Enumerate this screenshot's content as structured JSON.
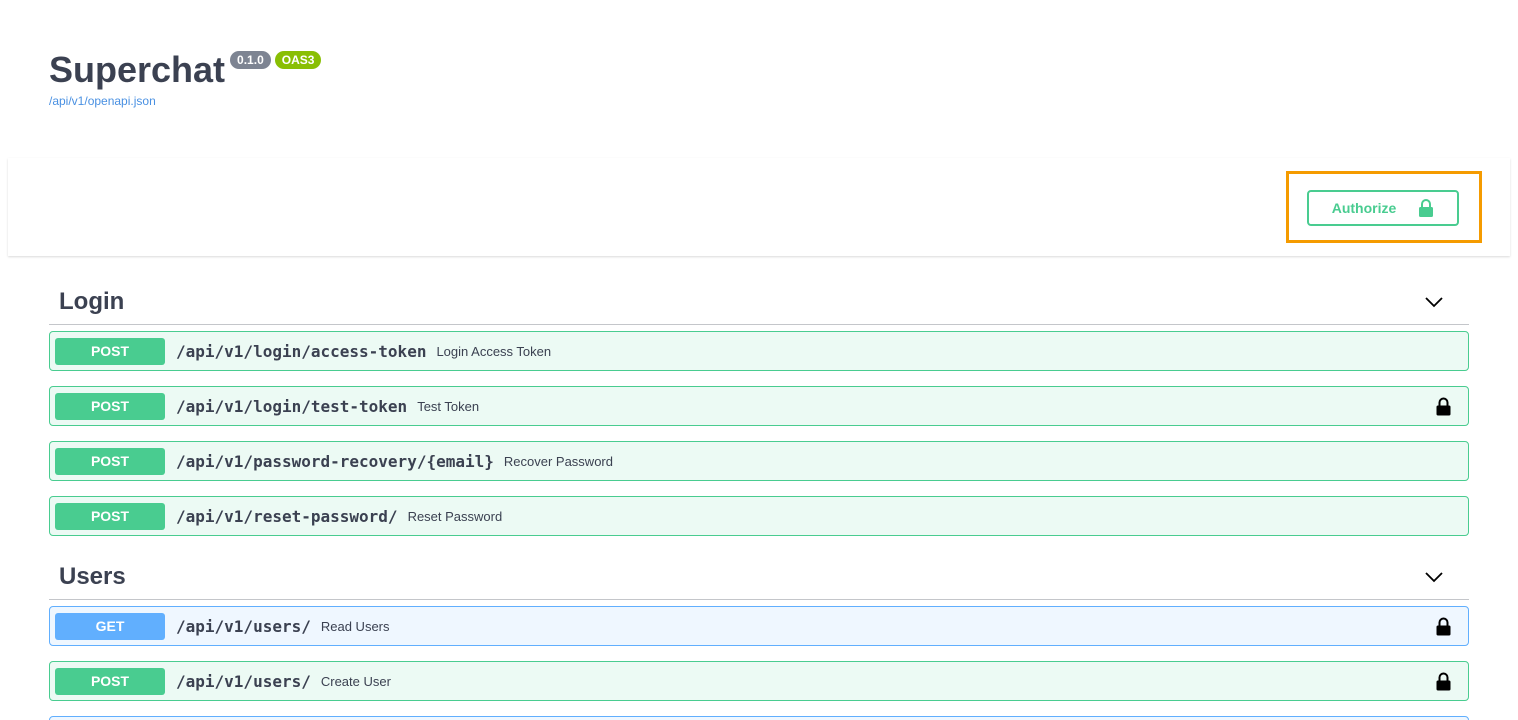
{
  "info": {
    "title": "Superchat",
    "version": "0.1.0",
    "oas": "OAS3",
    "spec_link": "/api/v1/openapi.json"
  },
  "auth": {
    "button_label": "Authorize",
    "icon": "lock-icon",
    "accent": "#49cc90",
    "highlight": "#f59b00"
  },
  "tags": [
    {
      "name": "Login",
      "operations": [
        {
          "method": "POST",
          "path": "/api/v1/login/access-token",
          "summary": "Login Access Token",
          "locked": false
        },
        {
          "method": "POST",
          "path": "/api/v1/login/test-token",
          "summary": "Test Token",
          "locked": true
        },
        {
          "method": "POST",
          "path": "/api/v1/password-recovery/{email}",
          "summary": "Recover Password",
          "locked": false
        },
        {
          "method": "POST",
          "path": "/api/v1/reset-password/",
          "summary": "Reset Password",
          "locked": false
        }
      ]
    },
    {
      "name": "Users",
      "operations": [
        {
          "method": "GET",
          "path": "/api/v1/users/",
          "summary": "Read Users",
          "locked": true
        },
        {
          "method": "POST",
          "path": "/api/v1/users/",
          "summary": "Create User",
          "locked": true
        }
      ]
    }
  ],
  "colors": {
    "post": "#49cc90",
    "get": "#61affe",
    "text": "#3b4151",
    "link": "#4990e2"
  }
}
